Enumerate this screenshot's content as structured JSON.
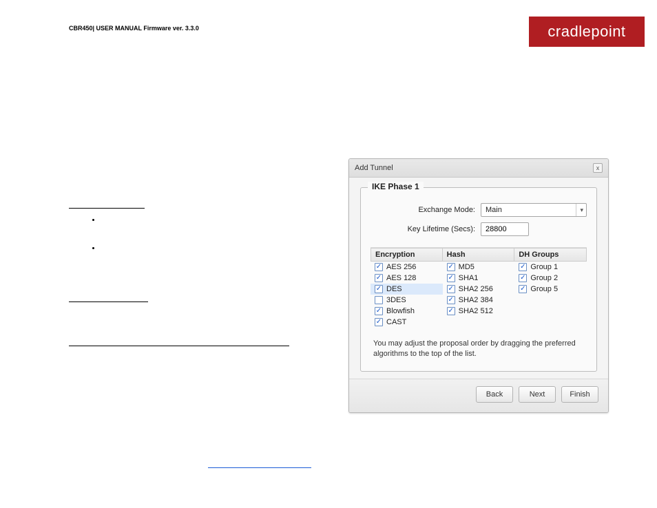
{
  "header": {
    "doc_title": "CBR450| USER MANUAL Firmware ver. 3.3.0",
    "brand": "cradlepoint"
  },
  "dialog": {
    "title": "Add Tunnel",
    "close_label": "x",
    "section_title": "IKE Phase 1",
    "exchange_mode_label": "Exchange Mode:",
    "exchange_mode_value": "Main",
    "key_lifetime_label": "Key Lifetime (Secs):",
    "key_lifetime_value": "28800",
    "columns": {
      "encryption": {
        "header": "Encryption",
        "items": [
          {
            "label": "AES 256",
            "checked": true,
            "hl": false
          },
          {
            "label": "AES 128",
            "checked": true,
            "hl": false
          },
          {
            "label": "DES",
            "checked": true,
            "hl": true
          },
          {
            "label": "3DES",
            "checked": false,
            "hl": false
          },
          {
            "label": "Blowfish",
            "checked": true,
            "hl": false
          },
          {
            "label": "CAST",
            "checked": true,
            "hl": false
          }
        ]
      },
      "hash": {
        "header": "Hash",
        "items": [
          {
            "label": "MD5",
            "checked": true
          },
          {
            "label": "SHA1",
            "checked": true
          },
          {
            "label": "SHA2 256",
            "checked": true
          },
          {
            "label": "SHA2 384",
            "checked": true
          },
          {
            "label": "SHA2 512",
            "checked": true
          }
        ]
      },
      "dh": {
        "header": "DH Groups",
        "items": [
          {
            "label": "Group 1",
            "checked": true
          },
          {
            "label": "Group 2",
            "checked": true
          },
          {
            "label": "Group 5",
            "checked": true
          }
        ]
      }
    },
    "hint": "You may adjust the proposal order by dragging the preferred algorithms to the top of the list.",
    "buttons": {
      "back": "Back",
      "next": "Next",
      "finish": "Finish"
    }
  }
}
